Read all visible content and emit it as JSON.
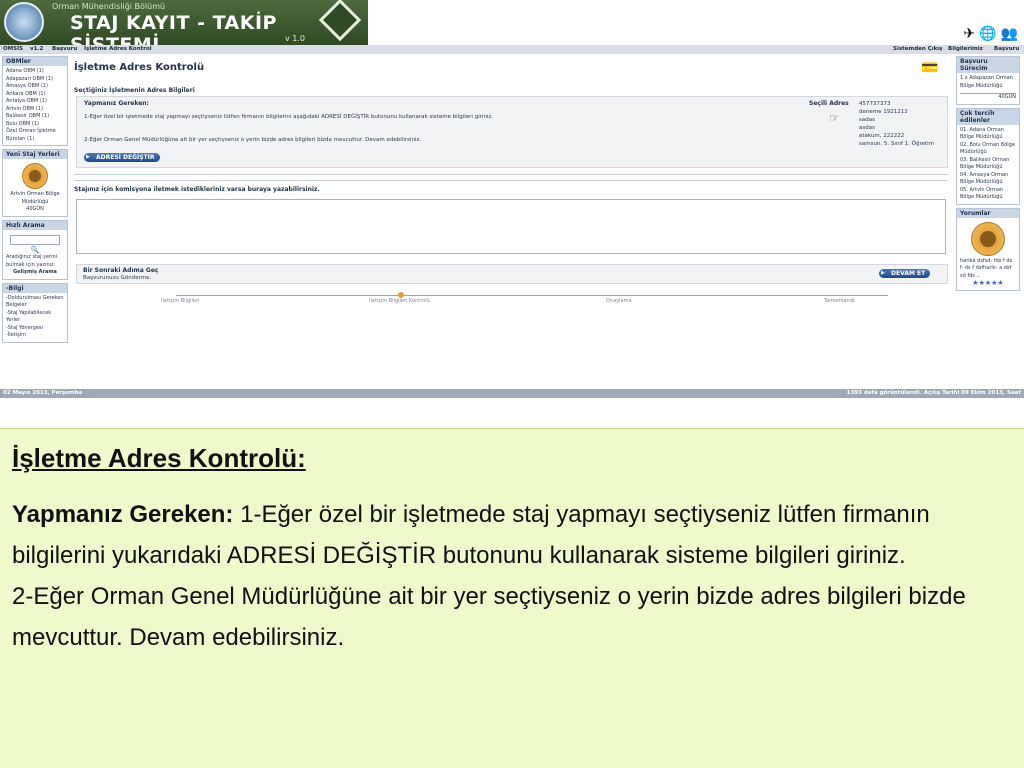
{
  "banner": {
    "dept": "Orman Mühendisliği Bölümü",
    "title": "STAJ KAYIT - TAKİP SİSTEMİ",
    "version": "v 1.0"
  },
  "menubar": {
    "items": [
      "OMSİS",
      "v1.2",
      "Başvuru",
      "İşletme Adres Kontrol"
    ],
    "right": [
      "Sistemden Çıkış",
      "Bilgilerimiz",
      "Başvuru"
    ]
  },
  "left": {
    "obm_header": "OBMler",
    "obm_items": [
      "Adana OBM (1)",
      "Adapazarı OBM (1)",
      "Amasya OBM (1)",
      "Ankara OBM (1)",
      "Antalya OBM (1)",
      "Artvin OBM (1)",
      "Balıkesir OBM (1)",
      "Bolu OBM (1)",
      "Özel Orman İşletme Büroları (1)"
    ],
    "new_header": "Yeni Staj Yerleri",
    "new_place": "Artvin Orman Bölge Müdürlüğü",
    "new_count": "40GÜN",
    "search_header": "Hızlı Arama",
    "search_hint": "Aradığınız staj yerini bulmak için yazınız.",
    "search_adv": "Gelişmiş Arama",
    "info_header": "-Bilgi",
    "info_items": [
      "-Doldurulması Gereken Belgeler",
      "-Staj Yapılabilecek Yerler",
      "-Staj Yönergesi",
      "-İletişim"
    ]
  },
  "main": {
    "title": "İşletme Adres Kontrolü",
    "section": "Seçtiğiniz İşletmenin Adres Bilgileri",
    "todo_header": "Yapmanız Gereken:",
    "todo_1": "1-Eğer özel bir işletmede staj yapmayı seçtiyseniz lütfen firmanın bilgilerini aşağıdaki ADRESİ DEĞİŞTİR butonunu kullanarak sisteme bilgileri giriniz.",
    "todo_2": "2-Eğer Orman Genel Müdürlüğüne ait bir yer seçtiyseniz o yerin bizde adres bilgileri bizde mevcuttur. Devam edebilirsiniz.",
    "change_btn": "ADRESİ DEĞİŞTİR",
    "selected_header": "Seçili Adres",
    "selected_lines": [
      "457737373",
      "deneme 1921212",
      "sadas",
      "asdas",
      "atakum, 222222",
      "samsun, 5. Sınıf 1. Öğretim"
    ],
    "comment_label": "Stajınız için komisyona iletmek istedikleriniz varsa buraya yazabilirsiniz.",
    "next_header": "Bir Sonraki Adıma Geç",
    "next_sub": "Başvurunuzu Gönderme.",
    "continue_btn": "DEVAM ET",
    "steps": [
      "İletişim Bilgileri",
      "İletişim Bilgileri Kontrolü",
      "Onaylama",
      "Tamamlandı"
    ]
  },
  "right": {
    "process_header": "Başvuru Sürecim",
    "process_item": "1 x Adapazarı Orman Bölge Müdürlüğü",
    "process_count": "40GÜN",
    "pref_header": "Çok tercih edilenler",
    "pref_items": [
      "01. Adana Orman Bölge Müdürlüğü",
      "02. Bolu Orman Bölge Müdürlüğü",
      "03. Balıkesir Orman Bölge Müdürlüğü",
      "04. Amasya Orman Bölge Müdürlüğü",
      "05. Artvin Orman Bölge Müdürlüğü"
    ],
    "comments_header": "Yorumlar",
    "comment_text": "harika dsfsd- fds f ds f- ds f dsfharik- a dsf sd fds ..",
    "stars": "★★★★★"
  },
  "bottombar": {
    "left": "02 Mayıs 2013, Perşembe",
    "right": "1393 defa görüntülendi. Açılış Tarihi 09 Ekim 2013, Saat"
  },
  "description": {
    "title": "İşletme Adres Kontrolü:",
    "lead": "Yapmanız Gereken:",
    "text1": " 1-Eğer özel bir işletmede staj yapmayı seçtiyseniz lütfen firmanın bilgilerini yukarıdaki ADRESİ DEĞİŞTİR butonunu kullanarak sisteme bilgileri giriniz.",
    "text2": "2-Eğer Orman Genel Müdürlüğüne ait bir yer seçtiyseniz o yerin bizde adres bilgileri bizde mevcuttur. Devam edebilirsiniz."
  }
}
